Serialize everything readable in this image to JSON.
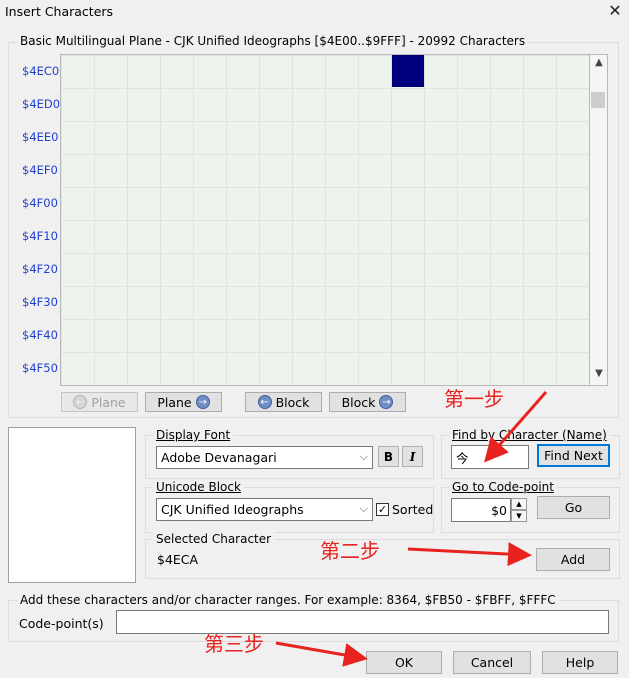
{
  "window": {
    "title": "Insert Characters",
    "close_glyph": "✕"
  },
  "plane_group": {
    "title": "Basic Multilingual Plane - CJK Unified Ideographs [$4E00..$9FFF] - 20992 Characters"
  },
  "row_labels": [
    "$4EC0",
    "$4ED0",
    "$4EE0",
    "$4EF0",
    "$4F00",
    "$4F10",
    "$4F20",
    "$4F30",
    "$4F40",
    "$4F50"
  ],
  "nav_buttons": {
    "plane_prev": "Plane",
    "plane_next": "Plane",
    "block_prev": "Block",
    "block_next": "Block"
  },
  "display_font": {
    "label": "Display Font",
    "value": "Adobe Devanagari",
    "bold_label": "B",
    "italic_label": "I"
  },
  "unicode_block": {
    "label": "Unicode Block",
    "value": "CJK Unified Ideographs",
    "sorted_label": "Sorted",
    "sorted_checked": true
  },
  "selected_character": {
    "label": "Selected Character",
    "value": "$4ECA",
    "add_label": "Add"
  },
  "find_by_character": {
    "label": "Find by Character (Name)",
    "value": "今",
    "find_next_label": "Find Next"
  },
  "goto_codepoint": {
    "label": "Go to Code-point",
    "value": "$0",
    "go_label": "Go"
  },
  "codepoints_group": {
    "title": "Add these characters and/or character ranges. For example: 8364, $FB50 - $FBFF, $FFFC",
    "field_label": "Code-point(s)",
    "field_value": ""
  },
  "footer": {
    "ok": "OK",
    "cancel": "Cancel",
    "help": "Help"
  },
  "annotations": {
    "step1": "第一步",
    "step2": "第二步",
    "step3": "第三步"
  },
  "colors": {
    "selected_cell": "#00007f",
    "row_label": "#1f3fd0",
    "annotation": "#e8231f",
    "default_button_border": "#0078d7"
  },
  "icons": {
    "left_arrow": "←",
    "right_arrow": "→",
    "dropdown": "⌵",
    "check": "✓",
    "scroll_up": "▲",
    "scroll_down": "▼"
  }
}
